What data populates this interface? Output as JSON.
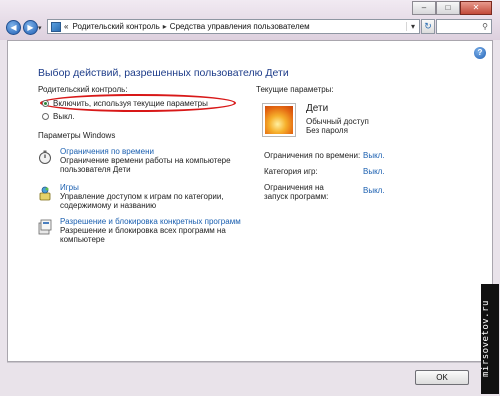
{
  "window": {
    "minimize": "–",
    "maximize": "□",
    "close": "✕"
  },
  "nav": {
    "back_icon": "arrow-left-icon",
    "forward_icon": "arrow-right-icon"
  },
  "address": {
    "chevrons": "«",
    "crumb1": "Родительский контроль",
    "separator": "▸",
    "crumb2": "Средства управления пользователем",
    "dropdown": "▾"
  },
  "search": {
    "placeholder": "",
    "icon": "search-icon",
    "glyph": "⚲"
  },
  "help": {
    "label": "?"
  },
  "main": {
    "title": "Выбор действий, разрешенных пользователю Дети",
    "parental_label": "Родительский контроль:",
    "radio_on_label": "Включить, используя текущие параметры",
    "radio_off_label": "Выкл.",
    "windows_settings_label": "Параметры Windows",
    "items": [
      {
        "link": "Ограничения по времени",
        "desc": "Ограничение времени работы на компьютере пользователя Дети"
      },
      {
        "link": "Игры",
        "desc": "Управление доступом к играм по категории, содержимому и названию"
      },
      {
        "link": "Разрешение и блокировка конкретных программ",
        "desc": "Разрешение и блокировка всех программ на компьютере"
      }
    ]
  },
  "current": {
    "label": "Текущие параметры:",
    "user_name": "Дети",
    "user_type": "Обычный доступ",
    "user_password": "Без пароля",
    "time_limits_label": "Ограничения по времени:",
    "time_limits_value": "Выкл.",
    "game_rating_label": "Категория игр:",
    "game_rating_value": "Выкл.",
    "program_limits_label_1": "Ограничения на",
    "program_limits_label_2": "запуск программ:",
    "program_limits_value": "Выкл."
  },
  "footer": {
    "ok": "OK"
  },
  "watermark": "mirsovetov.ru",
  "colors": {
    "link": "#1a5fb0",
    "title": "#1e3d8a",
    "highlight_ellipse": "#d81818"
  }
}
